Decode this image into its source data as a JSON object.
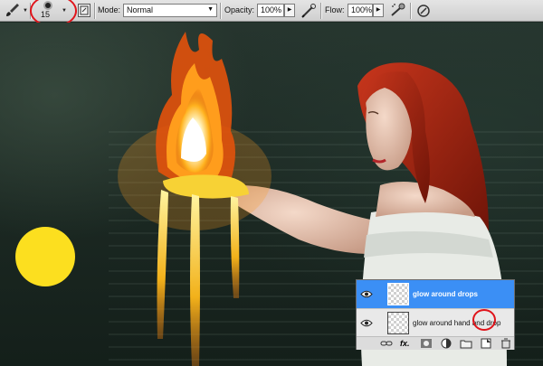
{
  "options_bar": {
    "brush_size": "15",
    "mode_label": "Mode:",
    "mode_value": "Normal",
    "opacity_label": "Opacity:",
    "opacity_value": "100%",
    "flow_label": "Flow:",
    "flow_value": "100%"
  },
  "layers_panel": {
    "layers": [
      {
        "name": "glow around drops",
        "selected": true
      },
      {
        "name": "glow around hand and drop",
        "selected": false
      }
    ],
    "buttons": [
      "link-icon",
      "fx-icon",
      "mask-icon",
      "adjustment-icon",
      "folder-icon",
      "new-layer-icon",
      "trash-icon"
    ]
  },
  "colors": {
    "selection": "#3b8ff5",
    "highlight_ring": "#e0141b",
    "yellow_circle": "#fcdf1f"
  }
}
